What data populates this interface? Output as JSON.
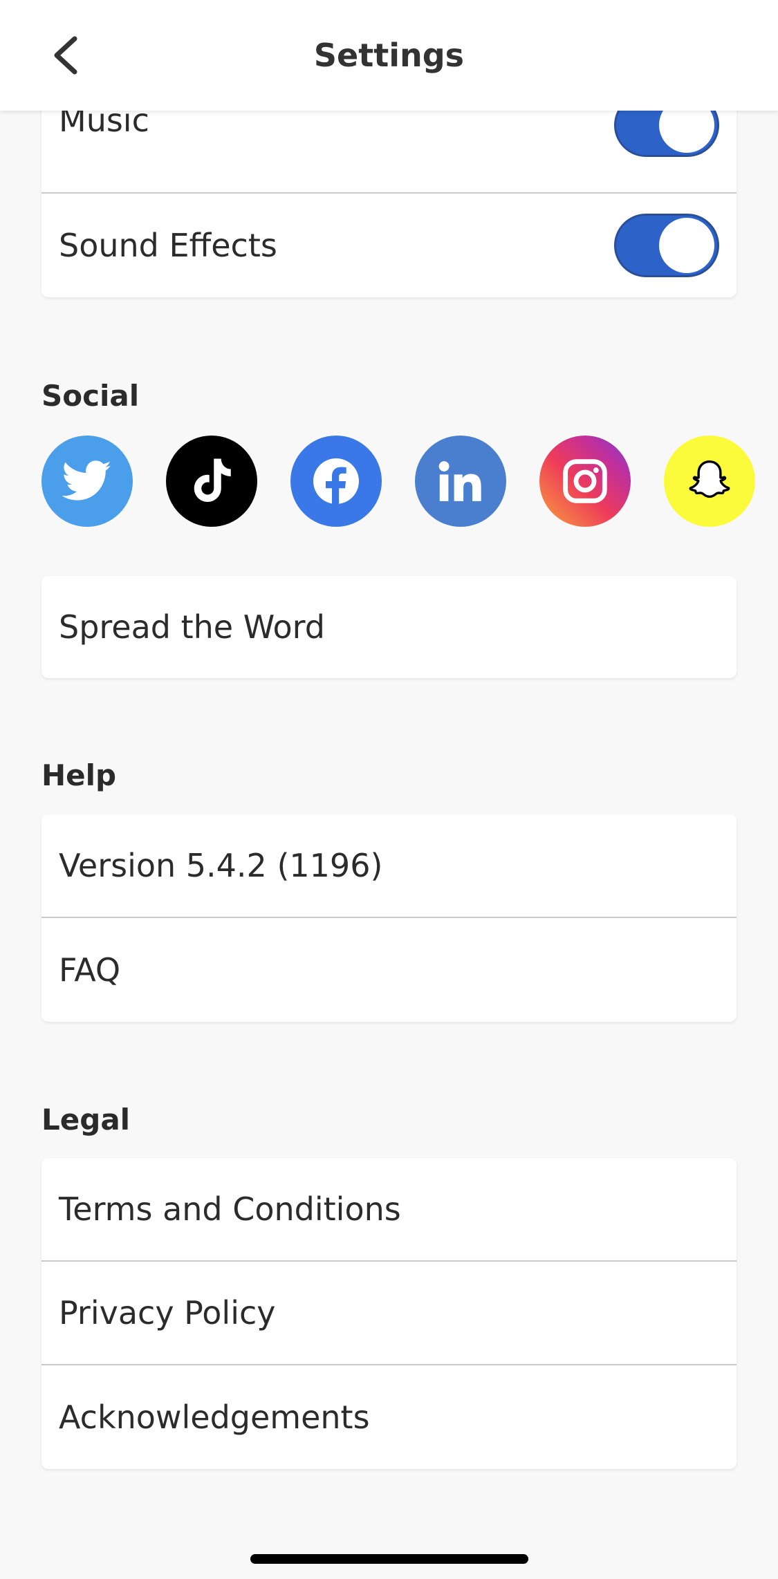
{
  "header": {
    "title": "Settings",
    "back_icon": "chevron-left-icon"
  },
  "sound": {
    "items": [
      {
        "label": "Music",
        "enabled": true
      },
      {
        "label": "Sound Effects",
        "enabled": true
      }
    ]
  },
  "social": {
    "title": "Social",
    "icons": [
      {
        "name": "twitter-icon",
        "color": "#4a9eea"
      },
      {
        "name": "tiktok-icon",
        "color": "#000000"
      },
      {
        "name": "facebook-icon",
        "color": "#3b78e7"
      },
      {
        "name": "linkedin-icon",
        "color": "#4a7ecf"
      },
      {
        "name": "instagram-icon",
        "color": "#d6327a"
      },
      {
        "name": "snapchat-icon",
        "color": "#fbfb3c"
      }
    ],
    "spread_label": "Spread the Word"
  },
  "help": {
    "title": "Help",
    "items": [
      {
        "label": "Version 5.4.2 (1196)"
      },
      {
        "label": "FAQ"
      }
    ]
  },
  "legal": {
    "title": "Legal",
    "items": [
      {
        "label": "Terms and Conditions"
      },
      {
        "label": "Privacy Policy"
      },
      {
        "label": "Acknowledgements"
      }
    ]
  },
  "colors": {
    "accent": "#2d63c8",
    "background": "#f8f8f8"
  }
}
